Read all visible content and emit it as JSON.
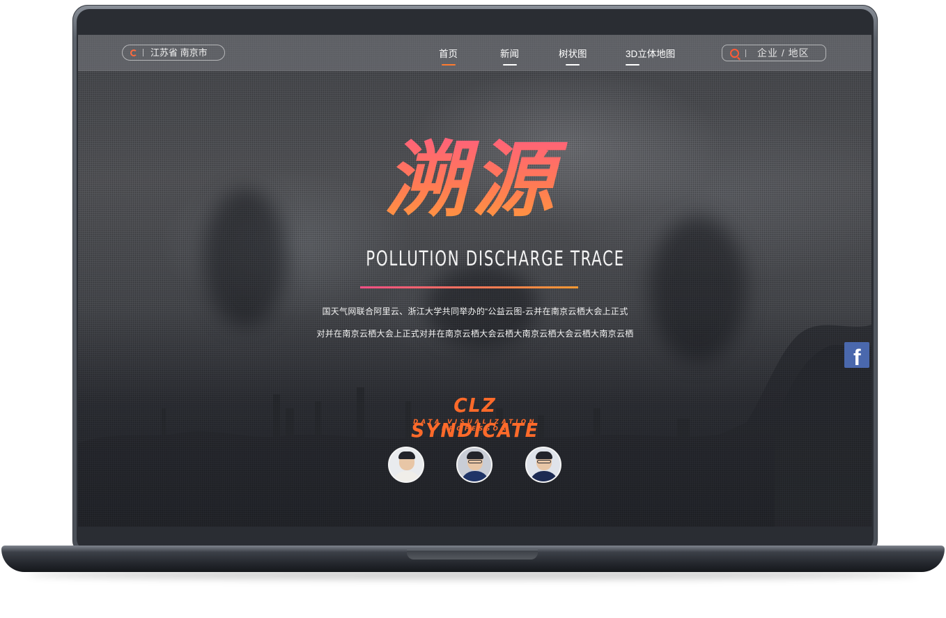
{
  "header": {
    "location": "江苏省 南京市",
    "nav": [
      {
        "label": "首页",
        "active": true
      },
      {
        "label": "新闻",
        "active": false
      },
      {
        "label": "树状图",
        "active": false
      },
      {
        "label": "3D立体地图",
        "active": false
      }
    ],
    "search_placeholder": "企业 / 地区"
  },
  "hero": {
    "title": "溯源",
    "subtitle": "POLLUTION DISCHARGE TRACE",
    "description_line1": "国天气网联合阿里云、浙江大学共同举办的“公益云图-云并在南京云栖大会上正式",
    "description_line2": "对并在南京云栖大会上正式对并在南京云栖大会云栖大南京云栖大会云栖大南京云栖"
  },
  "team": {
    "name": "CLZ SYNDICATE",
    "tagline": "DATA VISUALIZATION PROFESSOR",
    "member_count": 3
  },
  "social": {
    "facebook": "f"
  },
  "colors": {
    "accent": "#ff6a2a",
    "title_gradient_top": "#ff5f7e",
    "title_gradient_bottom": "#ff9a3c",
    "facebook": "#4a68ad"
  }
}
